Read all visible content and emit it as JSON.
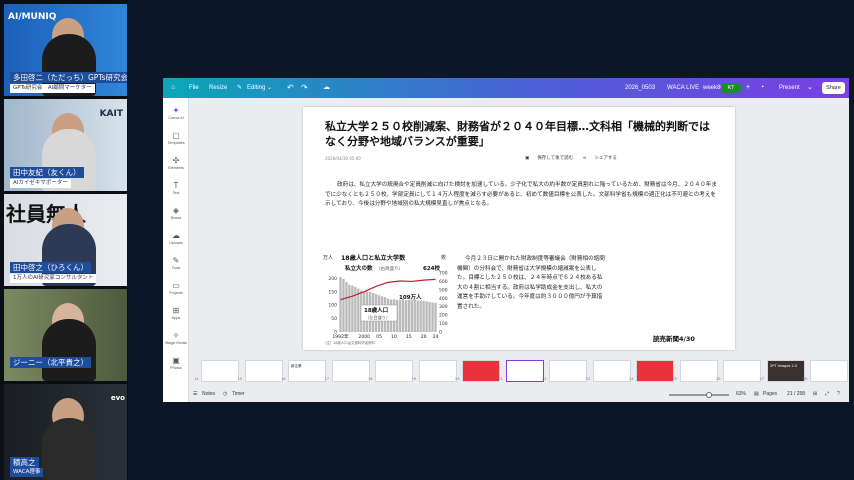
{
  "participants": [
    {
      "name": "多田啓二（ただっち）GPTs研究会",
      "role": "GPTs研究会　AI顧問マーケター",
      "bg": "AI/MUNIQ"
    },
    {
      "name": "田中友紀（友くん）",
      "role": "AIカイゼキサポーター",
      "bg": "KAIT"
    },
    {
      "name": "田中啓之（ひろくん）",
      "role": "1万人のAI研究家コンサルタント",
      "bg": "社員無人"
    },
    {
      "name": "ジーニー（北平貴之）",
      "role": "",
      "bg": ""
    },
    {
      "name": "積高之",
      "role": "WACA理事",
      "bg": "evo"
    }
  ],
  "editor": {
    "menu": {
      "file": "File",
      "resize": "Resize",
      "editing": "Editing"
    },
    "doc_title": "2026_0503",
    "doc_sub": "WACA LIVE",
    "doc_week": "week80",
    "avatar": "KT",
    "present": "Present",
    "share": "Share"
  },
  "sidebar": [
    {
      "icon": "✦",
      "label": "Canva AI"
    },
    {
      "icon": "▢",
      "label": "Templates"
    },
    {
      "icon": "✣",
      "label": "Elements"
    },
    {
      "icon": "T",
      "label": "Text"
    },
    {
      "icon": "◈",
      "label": "Brand"
    },
    {
      "icon": "☁",
      "label": "Uploads"
    },
    {
      "icon": "✎",
      "label": "Tools"
    },
    {
      "icon": "▭",
      "label": "Projects"
    },
    {
      "icon": "⊞",
      "label": "Apps"
    },
    {
      "icon": "✧",
      "label": "Magic Media"
    },
    {
      "icon": "▣",
      "label": "Photos"
    }
  ],
  "article": {
    "title": "私立大学２５０校削減案、財務省が２０４０年目標…文科相「機械的判断ではなく分野や地域バランスが重要」",
    "date": "2026/04/30 05:00",
    "save_label": "保存して後で読む",
    "share_label": "シェアする",
    "paragraph1": "政府は、私立大学の統廃合や定員削減に向けた検討を加速している。少子化で私大の約半数が定員割れに陥っているため、財務省は今月、２０４０年までに少なくとも２５０校、学部定員にして１４万人程度を減らす必要があると、初めて数値目標を公表した。文部科学省も規模の適正化は不可避との考えを示しており、今後は分野や地域別の私大規模見直しが焦点となる。",
    "paragraph2": "今月２３日に開かれた財政制度等審議会（財務相の諮問機関）の分科会で、財務省は大学規模の縮減案を公表した。目標とした２５０校は、２４年時点で６２４校ある私大の４割に相当する。政府は私学助成金を支出し、私大の運営を手助けしている。今年度は約３０００億円が予算措置された。",
    "credit": "読売新聞4/30"
  },
  "chart_data": {
    "type": "bar",
    "title": "18歳人口と私立大学数",
    "left_axis_unit": "万人",
    "right_axis_unit": "校",
    "x_ticks": [
      "1992年",
      "2000",
      "05",
      "10",
      "15",
      "20",
      "24"
    ],
    "series": [
      {
        "name": "18歳人口",
        "sublabel": "（左目盛り）",
        "kind": "bar",
        "x": [
          1992,
          1993,
          1994,
          1995,
          1996,
          1997,
          1998,
          1999,
          2000,
          2001,
          2002,
          2003,
          2004,
          2005,
          2006,
          2007,
          2008,
          2009,
          2010,
          2011,
          2012,
          2013,
          2014,
          2015,
          2016,
          2017,
          2018,
          2019,
          2020,
          2021,
          2022,
          2023,
          2024
        ],
        "values": [
          205,
          198,
          186,
          177,
          173,
          168,
          162,
          155,
          151,
          151,
          150,
          146,
          141,
          137,
          133,
          130,
          124,
          121,
          122,
          120,
          119,
          123,
          118,
          120,
          119,
          120,
          118,
          117,
          116,
          114,
          112,
          110,
          109
        ]
      },
      {
        "name": "私立大の数",
        "sublabel": "（右目盛り）",
        "kind": "line",
        "x": [
          1992,
          1996,
          2000,
          2004,
          2008,
          2012,
          2016,
          2020,
          2024
        ],
        "values": [
          384,
          425,
          478,
          542,
          589,
          605,
          600,
          615,
          624
        ]
      }
    ],
    "annotations": [
      "624校",
      "109万人"
    ],
    "left_ticks": [
      0,
      50,
      100,
      150,
      200
    ],
    "left_ylim": [
      0,
      220
    ],
    "right_ticks": [
      0,
      100,
      200,
      300,
      400,
      500,
      600,
      700
    ],
    "right_ylim": [
      0,
      700
    ],
    "source_note": "（注）18歳人口は文部科学省資料"
  },
  "filmstrip": [
    {
      "num": "14",
      "title": "",
      "style": ""
    },
    {
      "num": "15",
      "title": "",
      "style": ""
    },
    {
      "num": "16",
      "title": "新企業",
      "style": ""
    },
    {
      "num": "17",
      "title": "",
      "style": ""
    },
    {
      "num": "18",
      "title": "",
      "style": ""
    },
    {
      "num": "19",
      "title": "",
      "style": ""
    },
    {
      "num": "20",
      "title": "",
      "style": "red"
    },
    {
      "num": "21",
      "title": "",
      "style": "selected"
    },
    {
      "num": "22",
      "title": "",
      "style": ""
    },
    {
      "num": "23",
      "title": "",
      "style": ""
    },
    {
      "num": "24",
      "title": "",
      "style": "red"
    },
    {
      "num": "25",
      "title": "",
      "style": ""
    },
    {
      "num": "26",
      "title": "",
      "style": ""
    },
    {
      "num": "27",
      "title": "GPT Images 2.0",
      "style": "dark"
    },
    {
      "num": "28",
      "title": "",
      "style": ""
    }
  ],
  "bottombar": {
    "notes": "Notes",
    "timer": "Timer",
    "zoom": "63%",
    "pages": "Pages",
    "page_count": "21 / 258"
  }
}
